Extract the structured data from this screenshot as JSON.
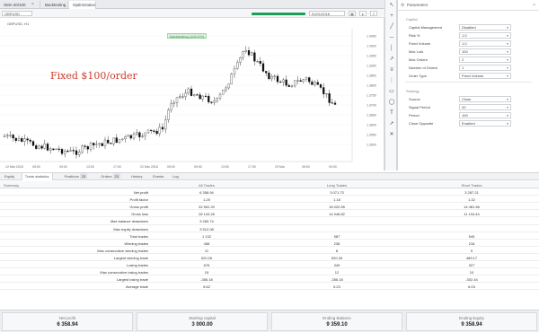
{
  "tabs": [
    {
      "label": "SMA 20/100",
      "active": false
    },
    {
      "label": "Backtesting",
      "active": false
    },
    {
      "label": "Optimization",
      "active": true
    }
  ],
  "chart": {
    "symbol": "GBPUSD",
    "title": "GBPUSD, H1",
    "badge": "Backtesting (100.0%)",
    "date_value": "01/01/2018",
    "annotation": "Fixed $100/order",
    "price_ticks": [
      "1.4050",
      "1.4000",
      "1.3950",
      "1.3900",
      "1.3850",
      "1.3800",
      "1.3750",
      "1.3700",
      "1.3650",
      "1.3600",
      "1.3550",
      "1.3500"
    ],
    "time_ticks": [
      "12 Mar 2018",
      "05:00",
      "09:00",
      "13:00",
      "17:00",
      "22 Mar 2018",
      "05:00",
      "09:00",
      "13:00",
      "17:00",
      "23 Mar",
      "05:00",
      "09:00"
    ]
  },
  "params": {
    "title": "Parameters",
    "sections": [
      {
        "name": "Capital",
        "rows": [
          {
            "label": "Capital Management",
            "value": "Disabled"
          },
          {
            "label": "Risk %",
            "value": "1.0"
          },
          {
            "label": "Fixed Volume",
            "value": "1.0"
          },
          {
            "label": "Max Lots",
            "value": "100"
          },
          {
            "label": "Max Orders",
            "value": "2"
          },
          {
            "label": "Number of Orders",
            "value": "1"
          },
          {
            "label": "Order Type",
            "value": "Fixed Volume"
          }
        ]
      },
      {
        "name": "Strategy",
        "rows": [
          {
            "label": "Source",
            "value": "Close"
          },
          {
            "label": "Signal Period",
            "value": "20"
          },
          {
            "label": "Period",
            "value": "100"
          },
          {
            "label": "Close Opposite",
            "value": "Enabled"
          }
        ]
      }
    ]
  },
  "bottom_tabs": [
    {
      "label": "Equity",
      "badge": "",
      "active": false
    },
    {
      "label": "Trade statistics",
      "badge": "",
      "active": true
    },
    {
      "label": "Positions",
      "badge": "23",
      "active": false
    },
    {
      "label": "Orders",
      "badge": "23",
      "active": false
    },
    {
      "label": "History",
      "badge": "",
      "active": false
    },
    {
      "label": "Events",
      "badge": "",
      "active": false
    },
    {
      "label": "Log",
      "badge": "",
      "active": false
    }
  ],
  "summary": {
    "headers": [
      "Summary",
      "All Trades",
      "Long Trades",
      "Short Trades"
    ],
    "rows": [
      [
        "Net profit",
        "6 358.94",
        "3 071.73",
        "3 287.21"
      ],
      [
        "Profit factor",
        "1.25",
        "1.18",
        "1.32"
      ],
      [
        "Gross profit",
        "32 502.20",
        "18 020.55",
        "14 481.65"
      ],
      [
        "Gross loss",
        "26 143.26",
        "14 948.82",
        "11 194.44"
      ],
      [
        "Max balance drawdown",
        "3 260.74",
        "",
        ""
      ],
      [
        "Max equity drawdown",
        "3 512.08",
        "",
        ""
      ],
      [
        "Total trades",
        "1 132",
        "587",
        "545"
      ],
      [
        "Winning trades",
        "456",
        "238",
        "218"
      ],
      [
        "Max consecutive winning trades",
        "11",
        "8",
        "9"
      ],
      [
        "Largest winning trade",
        "520.26",
        "520.26",
        "489.17"
      ],
      [
        "Losing trades",
        "676",
        "349",
        "327"
      ],
      [
        "Max consecutive losing trades",
        "15",
        "12",
        "10"
      ],
      [
        "Largest losing trade",
        "-356.18",
        "-356.18",
        "-302.44"
      ],
      [
        "Average trade",
        "5.62",
        "5.23",
        "6.03"
      ]
    ]
  },
  "stats": [
    {
      "label": "Net profit",
      "value": "6 358.94"
    },
    {
      "label": "Starting capital",
      "value": "3 000.00"
    },
    {
      "label": "Ending Balance",
      "value": "9 359.10"
    },
    {
      "label": "Ending Equity",
      "value": "9 358.94"
    }
  ],
  "colors": {
    "bullish": "#ffffff",
    "bearish": "#111111",
    "annotation": "#d43c2c",
    "progress": "#1b9e5a"
  }
}
